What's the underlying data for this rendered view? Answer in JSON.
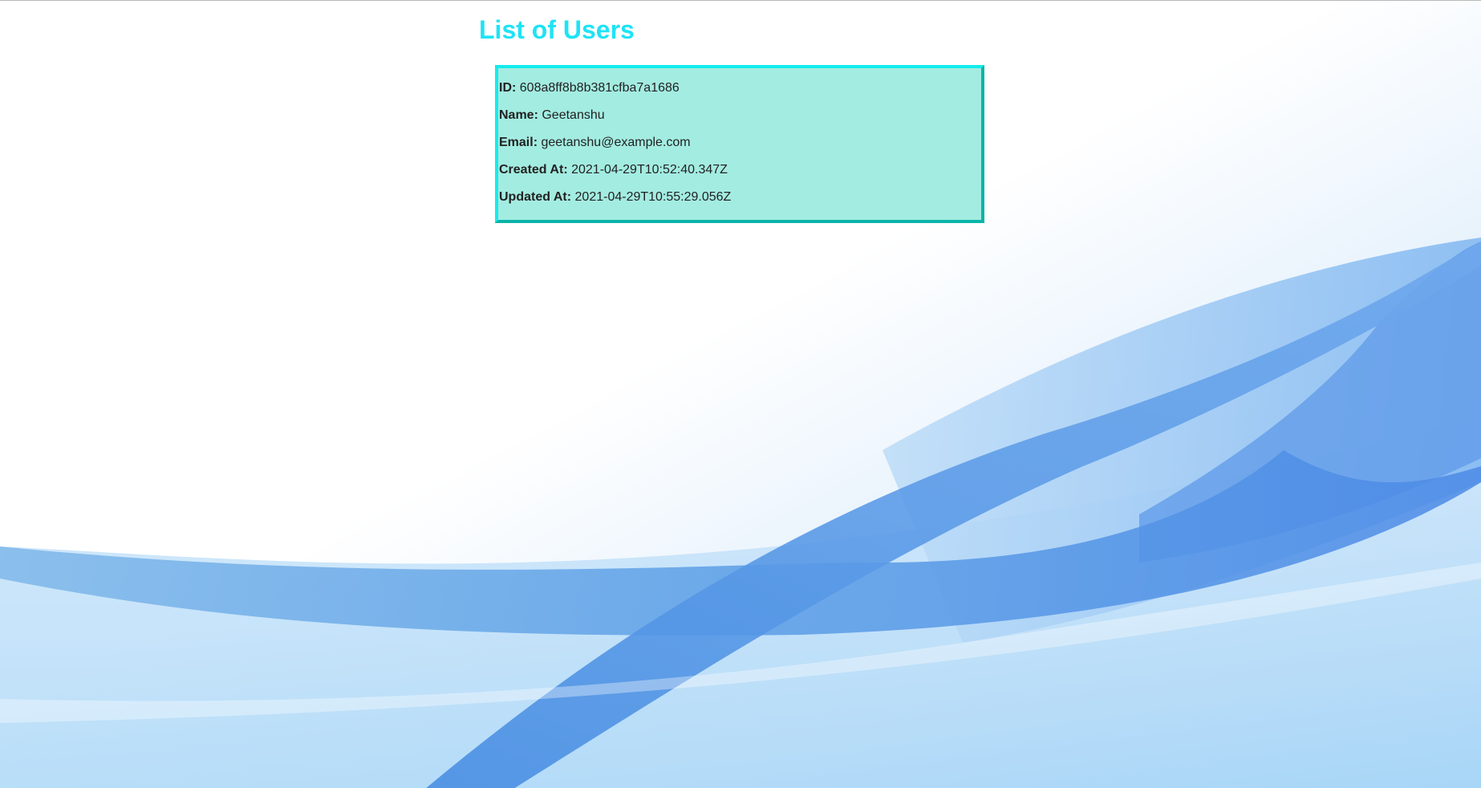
{
  "page": {
    "title": "List of Users"
  },
  "users": [
    {
      "id_label": "ID:",
      "id": "608a8ff8b8b381cfba7a1686",
      "name_label": "Name:",
      "name": "Geetanshu",
      "email_label": "Email:",
      "email": "geetanshu@example.com",
      "created_label": "Created At:",
      "created_at": "2021-04-29T10:52:40.347Z",
      "updated_label": "Updated At:",
      "updated_at": "2021-04-29T10:55:29.056Z"
    }
  ],
  "colors": {
    "title": "#1ee3f5",
    "card_background": "#a3ece1",
    "card_border_light": "#12ecec",
    "card_border_dark": "#0bb4a8",
    "wave_blue": "#4a8fe6"
  }
}
